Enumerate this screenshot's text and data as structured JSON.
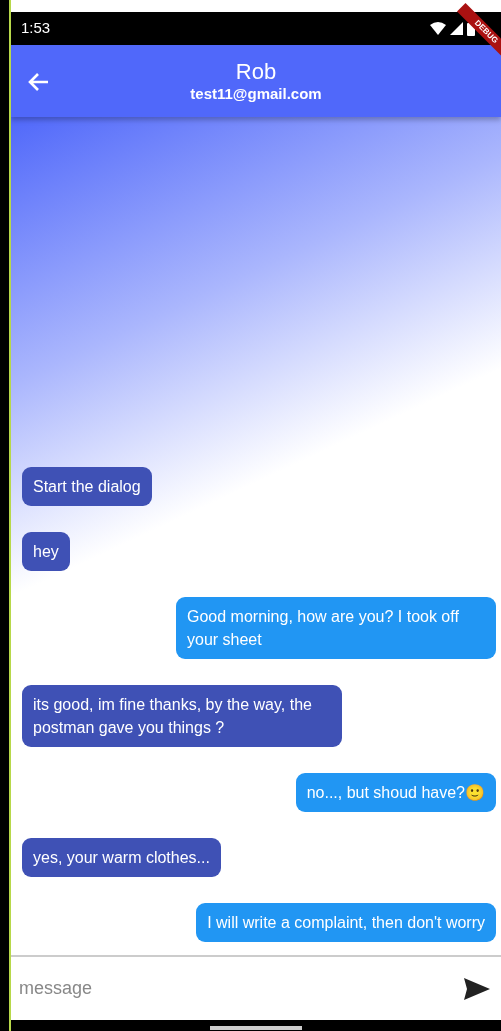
{
  "status_bar": {
    "time": "1:53"
  },
  "debug_banner": "DEBUG",
  "app_bar": {
    "title": "Rob",
    "subtitle": "test11@gmail.com"
  },
  "messages": [
    {
      "kind": "received",
      "text": "Start the dialog"
    },
    {
      "kind": "received",
      "text": "hey"
    },
    {
      "kind": "sent",
      "text": "Good morning, how are you? I took off your sheet"
    },
    {
      "kind": "received",
      "text": "its good, im fine thanks, by the way, the postman gave you things ?"
    },
    {
      "kind": "sent",
      "text": "no..., but shoud have?🙂"
    },
    {
      "kind": "received",
      "text": "yes, your warm clothes..."
    },
    {
      "kind": "sent",
      "text": "I will write a complaint, then don't worry"
    }
  ],
  "composer": {
    "placeholder": "message"
  }
}
